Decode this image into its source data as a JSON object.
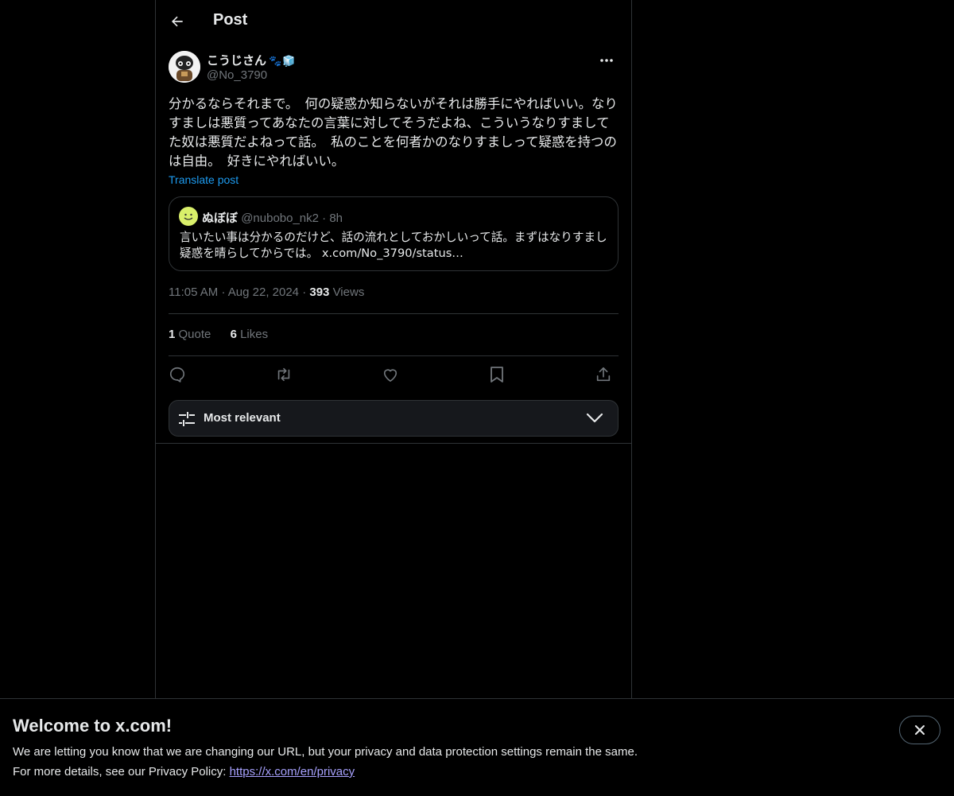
{
  "header": {
    "title": "Post"
  },
  "author": {
    "name": "こうじさん",
    "name_emoji": "🐾🧊",
    "handle": "@No_3790"
  },
  "post": {
    "text": "分かるならそれまで。　何の疑惑か知らないがそれは勝手にやればいい。なりすましは悪質ってあなたの言葉に対してそうだよね、こういうなりすましてた奴は悪質だよねって話。　私のことを何者かのなりすましって疑惑を持つのは自由。　好きにやればいい。",
    "translate_label": "Translate post"
  },
  "quote": {
    "name": "ぬぼぼ",
    "handle": "@nubobo_nk2",
    "separator": "·",
    "time": "8h",
    "text": "言いたい事は分かるのだけど、話の流れとしておかしいって話。まずはなりすまし疑惑を晴らしてからでは。 x.com/No_3790/status…"
  },
  "meta": {
    "time": "11:05 AM",
    "separator": "·",
    "date": "Aug 22, 2024",
    "views_count": "393",
    "views_label": "Views"
  },
  "stats": {
    "quotes_count": "1",
    "quotes_label": "Quote",
    "likes_count": "6",
    "likes_label": "Likes"
  },
  "sort": {
    "label": "Most relevant"
  },
  "banner": {
    "title": "Welcome to x.com!",
    "line1": "We are letting you know that we are changing our URL, but your privacy and data protection settings remain the same.",
    "line2_prefix": "For more details, see our Privacy Policy: ",
    "link": "https://x.com/en/privacy"
  },
  "colors": {
    "background": "#000000",
    "text": "#e7e9ea",
    "muted": "#71767b",
    "accent": "#1d9bf0",
    "border": "#2f3336",
    "link_visited": "#a8a2ff"
  },
  "icons": {
    "back": "arrow-left-icon",
    "more": "more-horizontal-icon",
    "reply": "reply-icon",
    "repost": "repost-icon",
    "like": "heart-icon",
    "bookmark": "bookmark-icon",
    "share": "share-icon",
    "sort": "sliders-icon",
    "chevron": "chevron-down-icon",
    "close": "close-icon"
  }
}
